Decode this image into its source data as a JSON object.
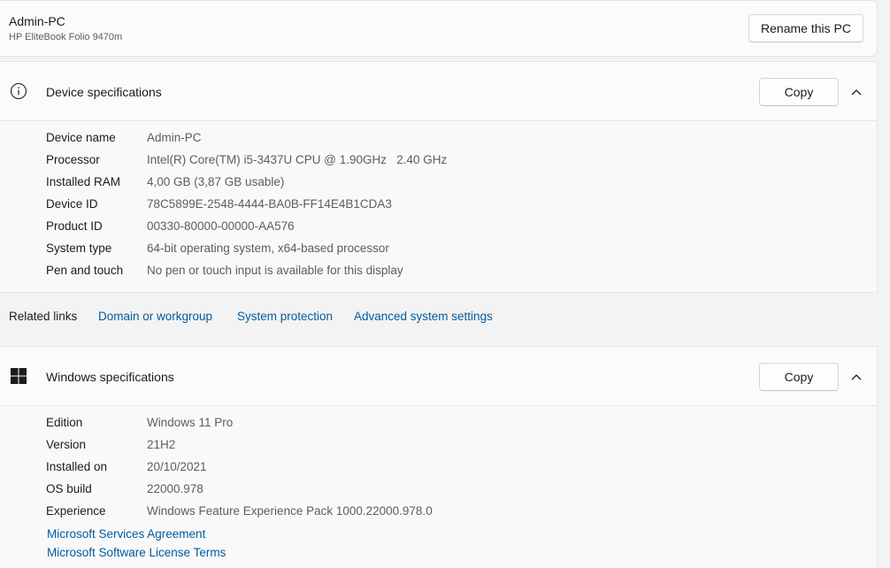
{
  "pc": {
    "name": "Admin-PC",
    "model": "HP EliteBook Folio 9470m",
    "rename_label": "Rename this PC"
  },
  "device_specs": {
    "title": "Device specifications",
    "copy_label": "Copy",
    "rows": [
      {
        "label": "Device name",
        "value": "Admin-PC"
      },
      {
        "label": "Processor",
        "value": "Intel(R) Core(TM) i5-3437U CPU @ 1.90GHz   2.40 GHz"
      },
      {
        "label": "Installed RAM",
        "value": "4,00 GB (3,87 GB usable)"
      },
      {
        "label": "Device ID",
        "value": "78C5899E-2548-4444-BA0B-FF14E4B1CDA3"
      },
      {
        "label": "Product ID",
        "value": "00330-80000-00000-AA576"
      },
      {
        "label": "System type",
        "value": "64-bit operating system, x64-based processor"
      },
      {
        "label": "Pen and touch",
        "value": "No pen or touch input is available for this display"
      }
    ]
  },
  "related_links": {
    "label": "Related links",
    "links": [
      "Domain or workgroup",
      "System protection",
      "Advanced system settings"
    ]
  },
  "windows_specs": {
    "title": "Windows specifications",
    "copy_label": "Copy",
    "rows": [
      {
        "label": "Edition",
        "value": "Windows 11 Pro"
      },
      {
        "label": "Version",
        "value": "21H2"
      },
      {
        "label": "Installed on",
        "value": "20/10/2021"
      },
      {
        "label": "OS build",
        "value": "22000.978"
      },
      {
        "label": "Experience",
        "value": "Windows Feature Experience Pack 1000.22000.978.0"
      }
    ],
    "links": [
      "Microsoft Services Agreement",
      "Microsoft Software License Terms"
    ]
  },
  "icons": {
    "device_specs": "info-icon",
    "windows_specs": "windows-logo-icon",
    "collapse": "chevron-up-icon"
  },
  "colors": {
    "link": "#005a9e",
    "card_bg": "#fbfbfb",
    "page_bg": "#f3f3f3"
  }
}
